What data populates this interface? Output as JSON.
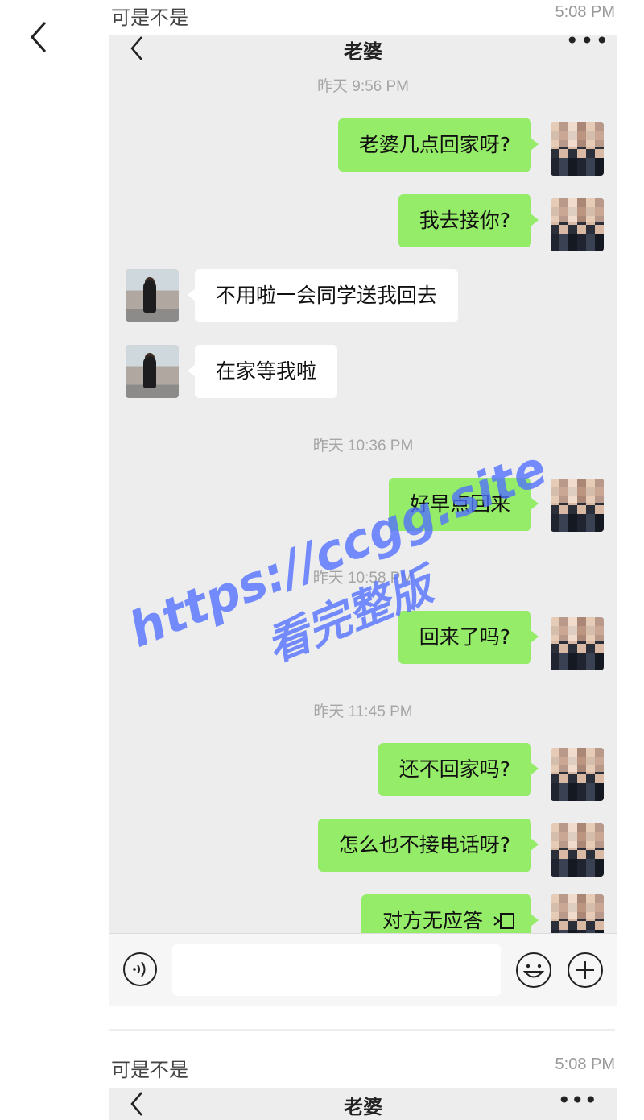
{
  "post_top": {
    "author": "可是不是",
    "time": "5:08 PM"
  },
  "chat": {
    "title": "老婆",
    "more": "•••",
    "messages": [
      {
        "type": "time",
        "text": "昨天 9:56 PM"
      },
      {
        "type": "msg",
        "from": "me",
        "text": "老婆几点回家呀?"
      },
      {
        "type": "msg",
        "from": "me",
        "text": "我去接你?"
      },
      {
        "type": "msg",
        "from": "her",
        "text": "不用啦一会同学送我回去"
      },
      {
        "type": "msg",
        "from": "her",
        "text": "在家等我啦"
      },
      {
        "type": "time",
        "text": "昨天 10:36 PM"
      },
      {
        "type": "msg",
        "from": "me",
        "text": "好早点回来"
      },
      {
        "type": "time",
        "text": "昨天 10:58 PM"
      },
      {
        "type": "msg",
        "from": "me",
        "text": "回来了吗?"
      },
      {
        "type": "time",
        "text": "昨天 11:45 PM"
      },
      {
        "type": "msg",
        "from": "me",
        "text": "还不回家吗?"
      },
      {
        "type": "msg",
        "from": "me",
        "text": "怎么也不接电话呀?"
      },
      {
        "type": "msg",
        "from": "me",
        "text": "对方无应答"
      }
    ]
  },
  "watermark": {
    "url": "https://ccgg.site",
    "tag": "看完整版"
  },
  "post_bottom": {
    "author": "可是不是",
    "time": "5:08 PM",
    "chat_title": "老婆",
    "more": "•••"
  },
  "colors": {
    "my_bubble": "#95ec69",
    "her_bubble": "#ffffff",
    "chat_bg": "#ededed",
    "watermark": "#506eff"
  }
}
